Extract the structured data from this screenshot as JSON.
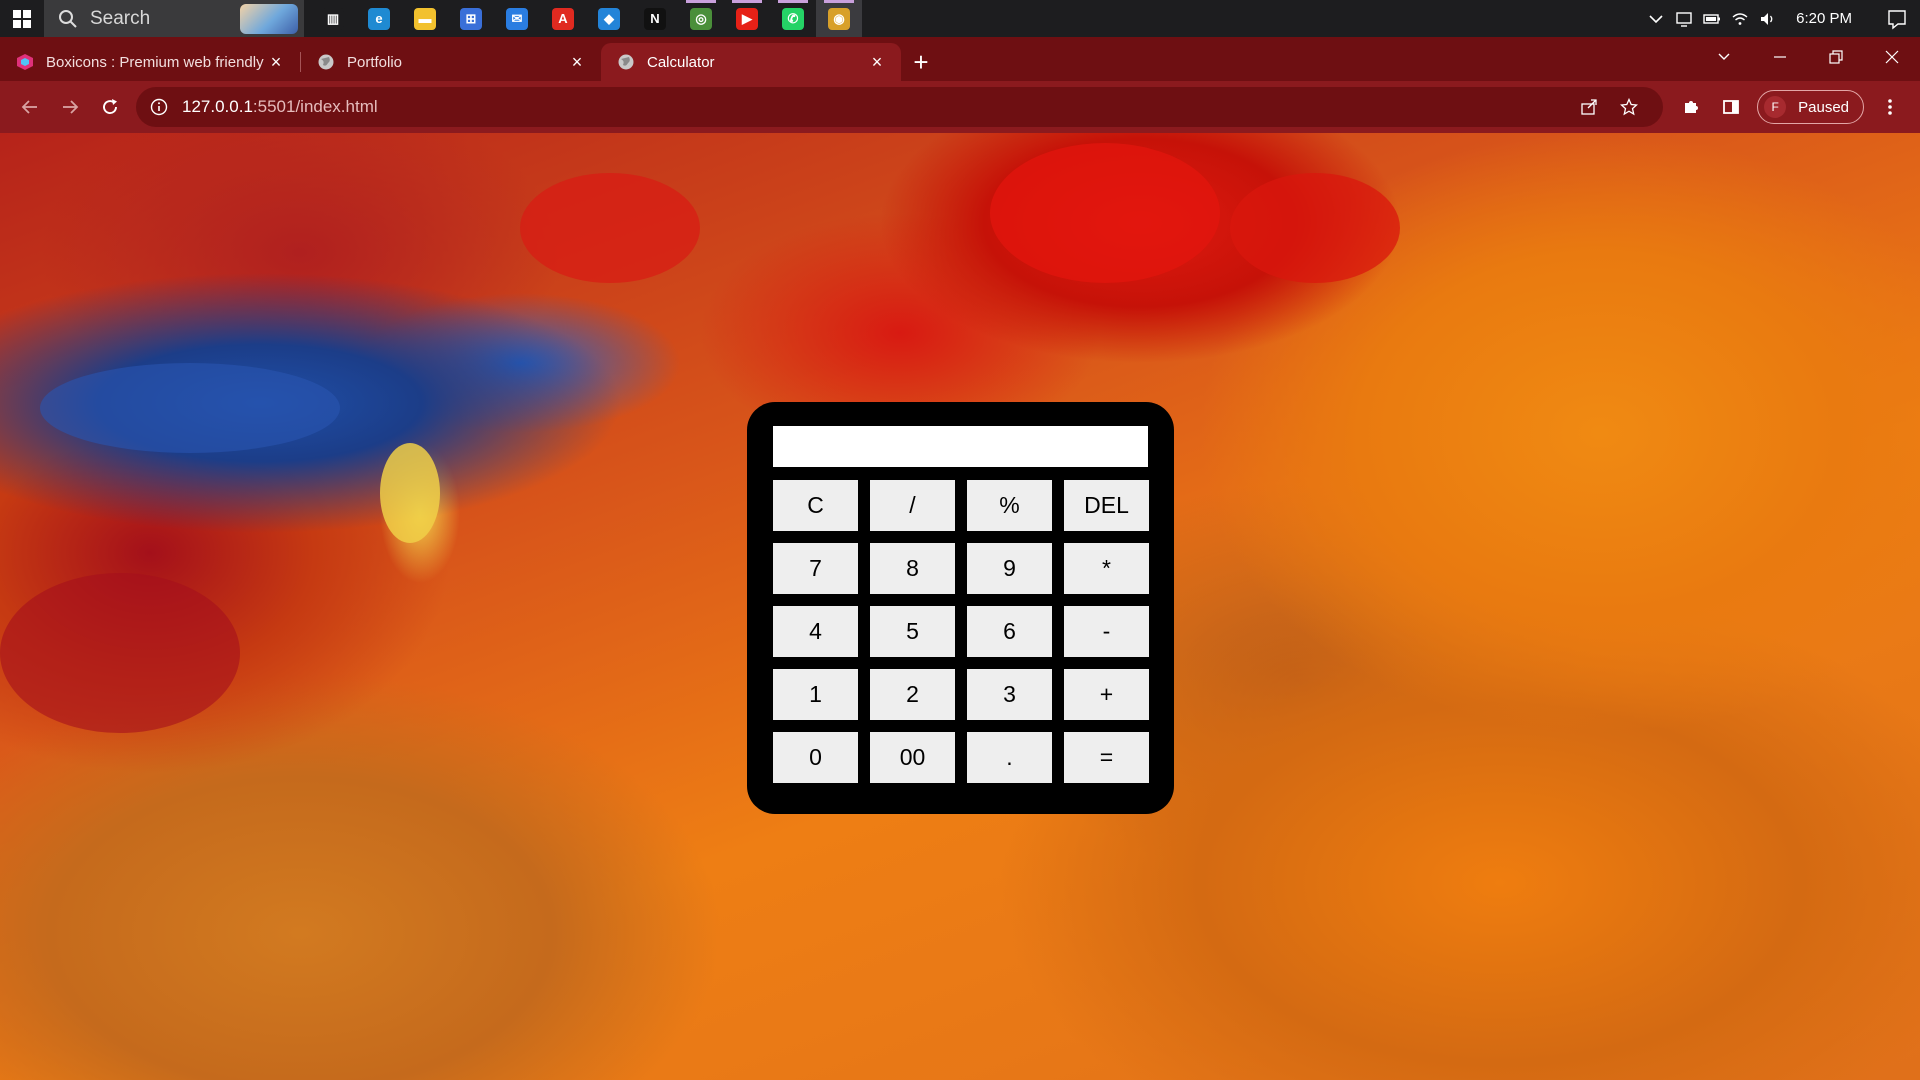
{
  "taskbar": {
    "search_label": "Search",
    "apps": [
      {
        "name": "task-view",
        "color": "#1d1d1f",
        "glyph": "▥"
      },
      {
        "name": "edge",
        "color": "#1f8ad2",
        "glyph": "e"
      },
      {
        "name": "file-explorer",
        "color": "#f2c12e",
        "glyph": "▬"
      },
      {
        "name": "microsoft-store",
        "color": "#3a6fd8",
        "glyph": "⊞"
      },
      {
        "name": "mail",
        "color": "#2a7de1",
        "glyph": "✉"
      },
      {
        "name": "acrobat",
        "color": "#e02a20",
        "glyph": "A"
      },
      {
        "name": "vscode",
        "color": "#2384d8",
        "glyph": "◆"
      },
      {
        "name": "netflix",
        "color": "#111111",
        "glyph": "N"
      },
      {
        "name": "chrome-profile",
        "color": "#4a8f3a",
        "glyph": "◎"
      },
      {
        "name": "youtube",
        "color": "#e62117",
        "glyph": "▶"
      },
      {
        "name": "whatsapp",
        "color": "#25d366",
        "glyph": "✆"
      },
      {
        "name": "chrome",
        "color": "#d8a02a",
        "glyph": "◉"
      }
    ],
    "clock": "6:20 PM"
  },
  "browser": {
    "tabs": [
      {
        "title": "Boxicons : Premium web friendly",
        "favicon": "boxicons-icon",
        "active": false
      },
      {
        "title": "Portfolio",
        "favicon": "globe-icon",
        "active": false
      },
      {
        "title": "Calculator",
        "favicon": "globe-icon",
        "active": true
      }
    ],
    "url_host": "127.0.0.1",
    "url_path": ":5501/index.html",
    "profile_initial": "F",
    "profile_status": "Paused"
  },
  "calculator": {
    "display_value": "",
    "keys": [
      "C",
      "/",
      "%",
      "DEL",
      "7",
      "8",
      "9",
      "*",
      "4",
      "5",
      "6",
      "-",
      "1",
      "2",
      "3",
      "+",
      "0",
      "00",
      ".",
      "="
    ]
  }
}
